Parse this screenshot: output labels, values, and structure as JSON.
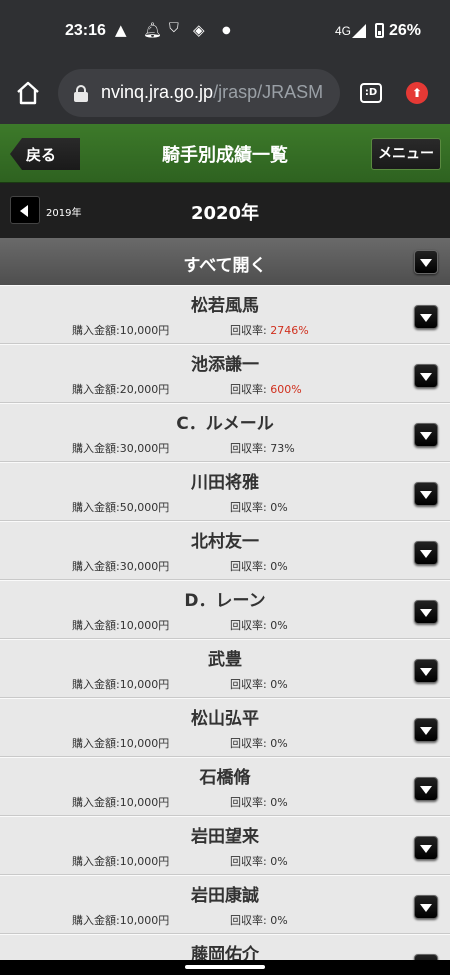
{
  "status": {
    "time": "23:16",
    "network": "4G",
    "battery": "26%"
  },
  "browser": {
    "url_host": "nvinq.jra.go.jp",
    "url_path": "/jrasp/JRASM",
    "tab_label": ":D"
  },
  "header": {
    "back_label": "戻る",
    "title": "騎手別成績一覧",
    "menu_label": "メニュー"
  },
  "yearbar": {
    "prev_label": "2019年",
    "current_label": "2020年"
  },
  "expand_all_label": "すべて開く",
  "labels": {
    "amount_prefix": "購入金額:",
    "rate_prefix": "回収率: "
  },
  "jockeys": [
    {
      "name": "松若風馬",
      "amount": "10,000円",
      "rate": "2746%",
      "highlight": true
    },
    {
      "name": "池添謙一",
      "amount": "20,000円",
      "rate": "600%",
      "highlight": true
    },
    {
      "name": "C．ルメール",
      "amount": "30,000円",
      "rate": "73%",
      "highlight": false
    },
    {
      "name": "川田将雅",
      "amount": "50,000円",
      "rate": "0%",
      "highlight": false
    },
    {
      "name": "北村友一",
      "amount": "30,000円",
      "rate": "0%",
      "highlight": false
    },
    {
      "name": "D．レーン",
      "amount": "10,000円",
      "rate": "0%",
      "highlight": false
    },
    {
      "name": "武豊",
      "amount": "10,000円",
      "rate": "0%",
      "highlight": false
    },
    {
      "name": "松山弘平",
      "amount": "10,000円",
      "rate": "0%",
      "highlight": false
    },
    {
      "name": "石橋脩",
      "amount": "10,000円",
      "rate": "0%",
      "highlight": false
    },
    {
      "name": "岩田望来",
      "amount": "10,000円",
      "rate": "0%",
      "highlight": false
    },
    {
      "name": "岩田康誠",
      "amount": "10,000円",
      "rate": "0%",
      "highlight": false
    },
    {
      "name": "藤岡佑介",
      "amount": "",
      "rate": "",
      "highlight": false
    }
  ],
  "colors": {
    "header_green": "#3d7a2a",
    "rate_highlight": "#d0301e"
  }
}
